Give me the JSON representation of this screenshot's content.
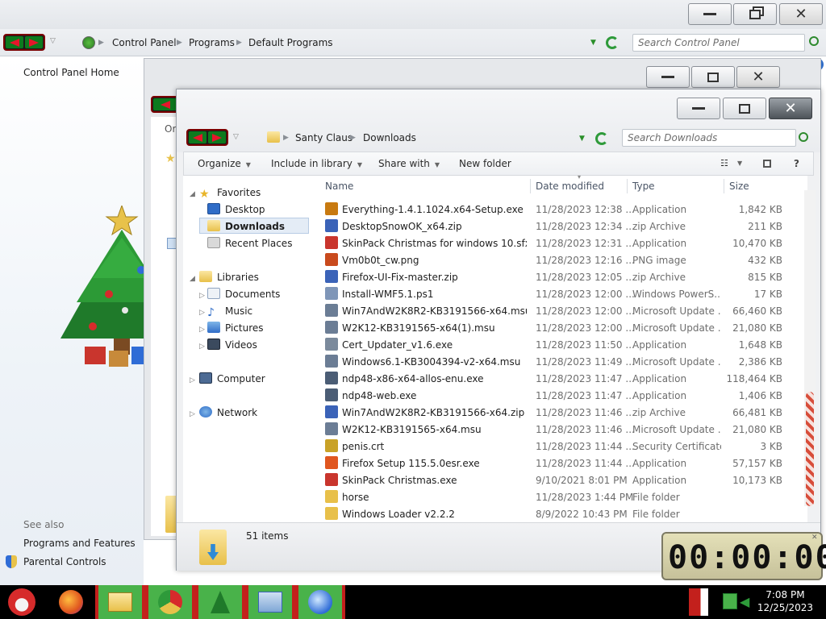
{
  "control_panel": {
    "breadcrumbs": [
      "Control Panel",
      "Programs",
      "Default Programs"
    ],
    "search_placeholder": "Search Control Panel",
    "home_link": "Control Panel Home",
    "see_also_heading": "See also",
    "see_also_links": [
      "Programs and Features",
      "Parental Controls"
    ]
  },
  "middle_window": {
    "partial_text": "Or"
  },
  "downloads": {
    "breadcrumbs": [
      "Santy Claus",
      "Downloads"
    ],
    "search_placeholder": "Search Downloads",
    "toolbar": {
      "organize": "Organize",
      "include": "Include in library",
      "share": "Share with",
      "new_folder": "New folder"
    },
    "nav": {
      "favorites": "Favorites",
      "desktop": "Desktop",
      "downloads": "Downloads",
      "recent": "Recent Places",
      "libraries": "Libraries",
      "documents": "Documents",
      "music": "Music",
      "pictures": "Pictures",
      "videos": "Videos",
      "computer": "Computer",
      "network": "Network"
    },
    "columns": {
      "name": "Name",
      "date": "Date modified",
      "type": "Type",
      "size": "Size"
    },
    "files": [
      {
        "name": "Everything-1.4.1.1024.x64-Setup.exe",
        "date": "11/28/2023 12:38 ...",
        "type": "Application",
        "size": "1,842 KB",
        "icon": "search-app-icon",
        "color": "#c87a10"
      },
      {
        "name": "DesktopSnowOK_x64.zip",
        "date": "11/28/2023 12:34 ...",
        "type": "zip Archive",
        "size": "211 KB",
        "icon": "zip-icon",
        "color": "#3b63b8"
      },
      {
        "name": "SkinPack Christmas for windows 10.sfx.exe",
        "date": "11/28/2023 12:31 ...",
        "type": "Application",
        "size": "10,470 KB",
        "icon": "app-icon",
        "color": "#c9352d"
      },
      {
        "name": "Vm0b0t_cw.png",
        "date": "11/28/2023 12:16 ...",
        "type": "PNG image",
        "size": "432 KB",
        "icon": "image-icon",
        "color": "#c94a1d"
      },
      {
        "name": "Firefox-UI-Fix-master.zip",
        "date": "11/28/2023 12:05 ...",
        "type": "zip Archive",
        "size": "815 KB",
        "icon": "zip-icon",
        "color": "#3b63b8"
      },
      {
        "name": "Install-WMF5.1.ps1",
        "date": "11/28/2023 12:00 ...",
        "type": "Windows PowerS...",
        "size": "17 KB",
        "icon": "script-icon",
        "color": "#7f96b8"
      },
      {
        "name": "Win7AndW2K8R2-KB3191566-x64.msu",
        "date": "11/28/2023 12:00 ...",
        "type": "Microsoft Update ...",
        "size": "66,460 KB",
        "icon": "update-icon",
        "color": "#6b7d95"
      },
      {
        "name": "W2K12-KB3191565-x64(1).msu",
        "date": "11/28/2023 12:00 ...",
        "type": "Microsoft Update ...",
        "size": "21,080 KB",
        "icon": "update-icon",
        "color": "#6b7d95"
      },
      {
        "name": "Cert_Updater_v1.6.exe",
        "date": "11/28/2023 11:50 ...",
        "type": "Application",
        "size": "1,648 KB",
        "icon": "app-icon",
        "color": "#7b8a9c"
      },
      {
        "name": "Windows6.1-KB3004394-v2-x64.msu",
        "date": "11/28/2023 11:49 ...",
        "type": "Microsoft Update ...",
        "size": "2,386 KB",
        "icon": "update-icon",
        "color": "#6b7d95"
      },
      {
        "name": "ndp48-x86-x64-allos-enu.exe",
        "date": "11/28/2023 11:47 ...",
        "type": "Application",
        "size": "118,464 KB",
        "icon": "installer-icon",
        "color": "#4b5d75"
      },
      {
        "name": "ndp48-web.exe",
        "date": "11/28/2023 11:47 ...",
        "type": "Application",
        "size": "1,406 KB",
        "icon": "installer-icon",
        "color": "#4b5d75"
      },
      {
        "name": "Win7AndW2K8R2-KB3191566-x64.zip",
        "date": "11/28/2023 11:46 ...",
        "type": "zip Archive",
        "size": "66,481 KB",
        "icon": "zip-icon",
        "color": "#3b63b8"
      },
      {
        "name": "W2K12-KB3191565-x64.msu",
        "date": "11/28/2023 11:46 ...",
        "type": "Microsoft Update ...",
        "size": "21,080 KB",
        "icon": "update-icon",
        "color": "#6b7d95"
      },
      {
        "name": "penis.crt",
        "date": "11/28/2023 11:44 ...",
        "type": "Security Certificate",
        "size": "3 KB",
        "icon": "certificate-icon",
        "color": "#c9a227"
      },
      {
        "name": "Firefox Setup 115.5.0esr.exe",
        "date": "11/28/2023 11:44 ...",
        "type": "Application",
        "size": "57,157 KB",
        "icon": "firefox-icon",
        "color": "#e0561f"
      },
      {
        "name": "SkinPack Christmas.exe",
        "date": "9/10/2021 8:01 PM",
        "type": "Application",
        "size": "10,173 KB",
        "icon": "app-icon",
        "color": "#c9352d"
      },
      {
        "name": "horse",
        "date": "11/28/2023 1:44 PM",
        "type": "File folder",
        "size": "",
        "icon": "folder-icon",
        "color": "#e8c04a"
      },
      {
        "name": "Windows Loader v2.2.2",
        "date": "8/9/2022 10:43 PM",
        "type": "File folder",
        "size": "",
        "icon": "folder-icon",
        "color": "#e8c04a"
      }
    ],
    "status": "51 items"
  },
  "timer": {
    "value": "00:00:00"
  },
  "taskbar": {
    "time": "7:08 PM",
    "date": "12/25/2023",
    "apps": [
      "santa-start-icon",
      "firefox-icon",
      "file-explorer-icon",
      "chrome-icon",
      "christmas-tree-icon",
      "control-panel-icon",
      "browser-icon"
    ]
  }
}
